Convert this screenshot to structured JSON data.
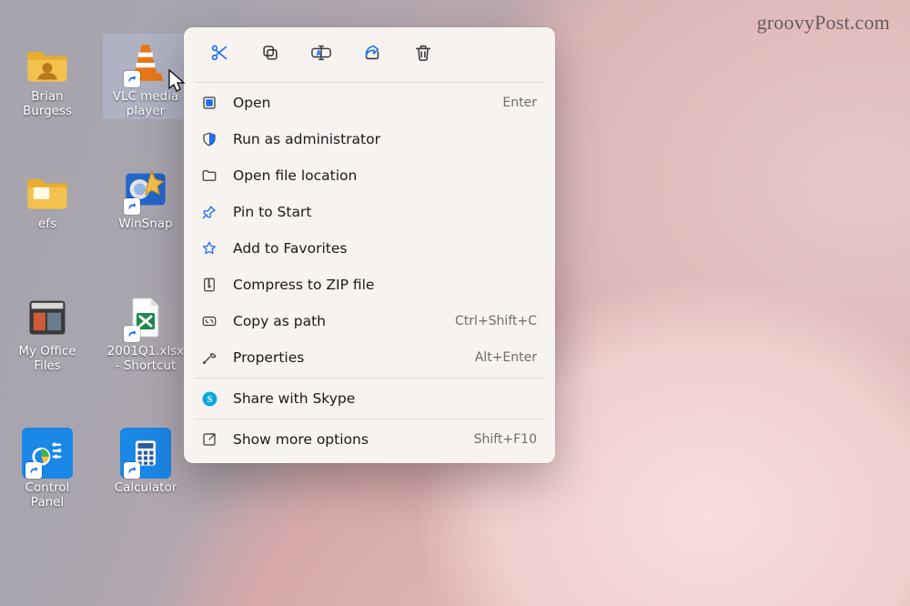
{
  "watermark": "groovyPost.com",
  "desktop_icons": [
    {
      "id": "user-folder",
      "label": "Brian Burgess",
      "shortcut": false
    },
    {
      "id": "vlc",
      "label": "VLC media player",
      "shortcut": true,
      "selected": true
    },
    {
      "id": "efs",
      "label": "efs",
      "shortcut": false
    },
    {
      "id": "winsnap",
      "label": "WinSnap",
      "shortcut": true
    },
    {
      "id": "office-files",
      "label": "My Office Files",
      "shortcut": false
    },
    {
      "id": "excel-sc",
      "label": "2001Q1.xlsx - Shortcut",
      "shortcut": true
    },
    {
      "id": "control-panel",
      "label": "Control Panel",
      "shortcut": true
    },
    {
      "id": "calculator",
      "label": "Calculator",
      "shortcut": true
    }
  ],
  "context_menu": {
    "top_actions": [
      {
        "id": "cut",
        "icon": "scissors-icon"
      },
      {
        "id": "copy",
        "icon": "copy-icon"
      },
      {
        "id": "rename",
        "icon": "rename-icon"
      },
      {
        "id": "share",
        "icon": "share-icon"
      },
      {
        "id": "delete",
        "icon": "trash-icon"
      }
    ],
    "groups": [
      [
        {
          "id": "open",
          "label": "Open",
          "shortcut": "Enter",
          "icon": "open-icon"
        },
        {
          "id": "run-admin",
          "label": "Run as administrator",
          "shortcut": "",
          "icon": "shield-icon"
        },
        {
          "id": "open-loc",
          "label": "Open file location",
          "shortcut": "",
          "icon": "folder-icon"
        },
        {
          "id": "pin-start",
          "label": "Pin to Start",
          "shortcut": "",
          "icon": "pin-icon"
        },
        {
          "id": "add-fav",
          "label": "Add to Favorites",
          "shortcut": "",
          "icon": "star-icon"
        },
        {
          "id": "compress",
          "label": "Compress to ZIP file",
          "shortcut": "",
          "icon": "zip-icon"
        },
        {
          "id": "copy-path",
          "label": "Copy as path",
          "shortcut": "Ctrl+Shift+C",
          "icon": "copypath-icon"
        },
        {
          "id": "properties",
          "label": "Properties",
          "shortcut": "Alt+Enter",
          "icon": "wrench-icon"
        }
      ],
      [
        {
          "id": "share-skype",
          "label": "Share with Skype",
          "shortcut": "",
          "icon": "skype-icon"
        }
      ],
      [
        {
          "id": "more-options",
          "label": "Show more options",
          "shortcut": "Shift+F10",
          "icon": "more-icon"
        }
      ]
    ]
  },
  "colors": {
    "accent": "#1b6ef3",
    "menu_bg": "#f7f3f1",
    "icon_stroke": "#3b3b3b"
  }
}
